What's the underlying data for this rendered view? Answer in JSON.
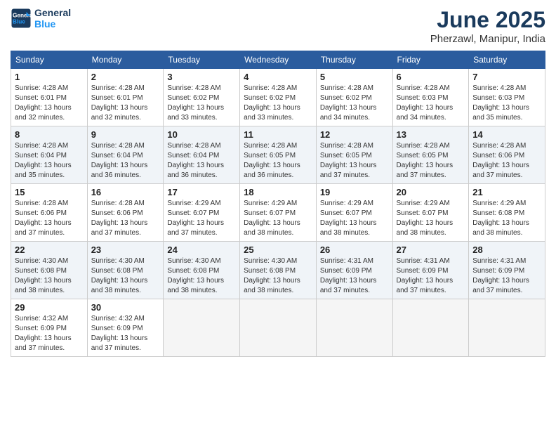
{
  "header": {
    "logo_line1": "General",
    "logo_line2": "Blue",
    "month": "June 2025",
    "location": "Pherzawl, Manipur, India"
  },
  "weekdays": [
    "Sunday",
    "Monday",
    "Tuesday",
    "Wednesday",
    "Thursday",
    "Friday",
    "Saturday"
  ],
  "weeks": [
    [
      {
        "day": "1",
        "info": "Sunrise: 4:28 AM\nSunset: 6:01 PM\nDaylight: 13 hours\nand 32 minutes."
      },
      {
        "day": "2",
        "info": "Sunrise: 4:28 AM\nSunset: 6:01 PM\nDaylight: 13 hours\nand 32 minutes."
      },
      {
        "day": "3",
        "info": "Sunrise: 4:28 AM\nSunset: 6:02 PM\nDaylight: 13 hours\nand 33 minutes."
      },
      {
        "day": "4",
        "info": "Sunrise: 4:28 AM\nSunset: 6:02 PM\nDaylight: 13 hours\nand 33 minutes."
      },
      {
        "day": "5",
        "info": "Sunrise: 4:28 AM\nSunset: 6:02 PM\nDaylight: 13 hours\nand 34 minutes."
      },
      {
        "day": "6",
        "info": "Sunrise: 4:28 AM\nSunset: 6:03 PM\nDaylight: 13 hours\nand 34 minutes."
      },
      {
        "day": "7",
        "info": "Sunrise: 4:28 AM\nSunset: 6:03 PM\nDaylight: 13 hours\nand 35 minutes."
      }
    ],
    [
      {
        "day": "8",
        "info": "Sunrise: 4:28 AM\nSunset: 6:04 PM\nDaylight: 13 hours\nand 35 minutes."
      },
      {
        "day": "9",
        "info": "Sunrise: 4:28 AM\nSunset: 6:04 PM\nDaylight: 13 hours\nand 36 minutes."
      },
      {
        "day": "10",
        "info": "Sunrise: 4:28 AM\nSunset: 6:04 PM\nDaylight: 13 hours\nand 36 minutes."
      },
      {
        "day": "11",
        "info": "Sunrise: 4:28 AM\nSunset: 6:05 PM\nDaylight: 13 hours\nand 36 minutes."
      },
      {
        "day": "12",
        "info": "Sunrise: 4:28 AM\nSunset: 6:05 PM\nDaylight: 13 hours\nand 37 minutes."
      },
      {
        "day": "13",
        "info": "Sunrise: 4:28 AM\nSunset: 6:05 PM\nDaylight: 13 hours\nand 37 minutes."
      },
      {
        "day": "14",
        "info": "Sunrise: 4:28 AM\nSunset: 6:06 PM\nDaylight: 13 hours\nand 37 minutes."
      }
    ],
    [
      {
        "day": "15",
        "info": "Sunrise: 4:28 AM\nSunset: 6:06 PM\nDaylight: 13 hours\nand 37 minutes."
      },
      {
        "day": "16",
        "info": "Sunrise: 4:28 AM\nSunset: 6:06 PM\nDaylight: 13 hours\nand 37 minutes."
      },
      {
        "day": "17",
        "info": "Sunrise: 4:29 AM\nSunset: 6:07 PM\nDaylight: 13 hours\nand 37 minutes."
      },
      {
        "day": "18",
        "info": "Sunrise: 4:29 AM\nSunset: 6:07 PM\nDaylight: 13 hours\nand 38 minutes."
      },
      {
        "day": "19",
        "info": "Sunrise: 4:29 AM\nSunset: 6:07 PM\nDaylight: 13 hours\nand 38 minutes."
      },
      {
        "day": "20",
        "info": "Sunrise: 4:29 AM\nSunset: 6:07 PM\nDaylight: 13 hours\nand 38 minutes."
      },
      {
        "day": "21",
        "info": "Sunrise: 4:29 AM\nSunset: 6:08 PM\nDaylight: 13 hours\nand 38 minutes."
      }
    ],
    [
      {
        "day": "22",
        "info": "Sunrise: 4:30 AM\nSunset: 6:08 PM\nDaylight: 13 hours\nand 38 minutes."
      },
      {
        "day": "23",
        "info": "Sunrise: 4:30 AM\nSunset: 6:08 PM\nDaylight: 13 hours\nand 38 minutes."
      },
      {
        "day": "24",
        "info": "Sunrise: 4:30 AM\nSunset: 6:08 PM\nDaylight: 13 hours\nand 38 minutes."
      },
      {
        "day": "25",
        "info": "Sunrise: 4:30 AM\nSunset: 6:08 PM\nDaylight: 13 hours\nand 38 minutes."
      },
      {
        "day": "26",
        "info": "Sunrise: 4:31 AM\nSunset: 6:09 PM\nDaylight: 13 hours\nand 37 minutes."
      },
      {
        "day": "27",
        "info": "Sunrise: 4:31 AM\nSunset: 6:09 PM\nDaylight: 13 hours\nand 37 minutes."
      },
      {
        "day": "28",
        "info": "Sunrise: 4:31 AM\nSunset: 6:09 PM\nDaylight: 13 hours\nand 37 minutes."
      }
    ],
    [
      {
        "day": "29",
        "info": "Sunrise: 4:32 AM\nSunset: 6:09 PM\nDaylight: 13 hours\nand 37 minutes."
      },
      {
        "day": "30",
        "info": "Sunrise: 4:32 AM\nSunset: 6:09 PM\nDaylight: 13 hours\nand 37 minutes."
      },
      {
        "day": "",
        "info": ""
      },
      {
        "day": "",
        "info": ""
      },
      {
        "day": "",
        "info": ""
      },
      {
        "day": "",
        "info": ""
      },
      {
        "day": "",
        "info": ""
      }
    ]
  ]
}
